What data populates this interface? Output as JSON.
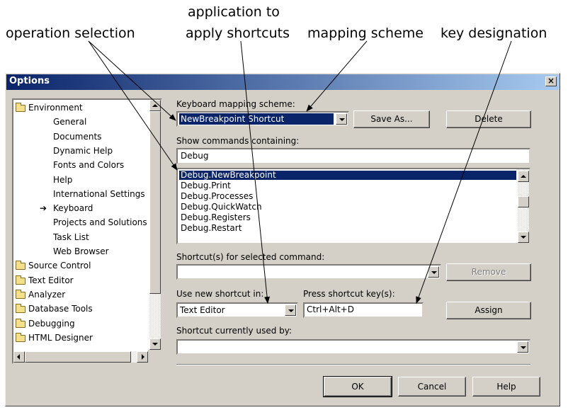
{
  "captions": {
    "operation_selection": "operation selection",
    "application_line1": "application to",
    "application_line2": "apply shortcuts",
    "mapping_scheme": "mapping scheme",
    "key_designation": "key designation"
  },
  "dialog": {
    "title": "Options",
    "close_glyph": "×"
  },
  "tree": {
    "items": [
      {
        "label": "Environment",
        "type": "folder-open"
      },
      {
        "label": "General",
        "type": "child"
      },
      {
        "label": "Documents",
        "type": "child"
      },
      {
        "label": "Dynamic Help",
        "type": "child"
      },
      {
        "label": "Fonts and Colors",
        "type": "child"
      },
      {
        "label": "Help",
        "type": "child"
      },
      {
        "label": "International Settings",
        "type": "child"
      },
      {
        "label": "Keyboard",
        "type": "child-current"
      },
      {
        "label": "Projects and Solutions",
        "type": "child"
      },
      {
        "label": "Task List",
        "type": "child"
      },
      {
        "label": "Web Browser",
        "type": "child"
      },
      {
        "label": "Source Control",
        "type": "folder"
      },
      {
        "label": "Text Editor",
        "type": "folder"
      },
      {
        "label": "Analyzer",
        "type": "folder"
      },
      {
        "label": "Database Tools",
        "type": "folder"
      },
      {
        "label": "Debugging",
        "type": "folder"
      },
      {
        "label": "HTML Designer",
        "type": "folder"
      }
    ]
  },
  "mapping": {
    "label": "Keyboard mapping scheme:",
    "value": "NewBreakpoint Shortcut",
    "save_as": "Save As...",
    "delete": "Delete"
  },
  "show_commands": {
    "label": "Show commands containing:",
    "value": "Debug"
  },
  "commands": [
    {
      "label": "Debug.NewBreakpoint",
      "selected": true
    },
    {
      "label": "Debug.Print",
      "selected": false
    },
    {
      "label": "Debug.Processes",
      "selected": false
    },
    {
      "label": "Debug.QuickWatch",
      "selected": false
    },
    {
      "label": "Debug.Registers",
      "selected": false
    },
    {
      "label": "Debug.Restart",
      "selected": false
    }
  ],
  "shortcuts_for_cmd": {
    "label": "Shortcut(s) for selected command:",
    "value": "",
    "remove": "Remove"
  },
  "use_new_shortcut": {
    "label": "Use new shortcut in:",
    "value": "Text Editor"
  },
  "press_key": {
    "label": "Press shortcut key(s):",
    "value": "Ctrl+Alt+D",
    "assign": "Assign"
  },
  "currently_used": {
    "label": "Shortcut currently used by:",
    "value": ""
  },
  "footer": {
    "ok": "OK",
    "cancel": "Cancel",
    "help": "Help"
  },
  "colors": {
    "dialog_face": "#d4d0c8",
    "title_start": "#0a246a",
    "title_end": "#a6caf0",
    "selection": "#0a246a"
  }
}
